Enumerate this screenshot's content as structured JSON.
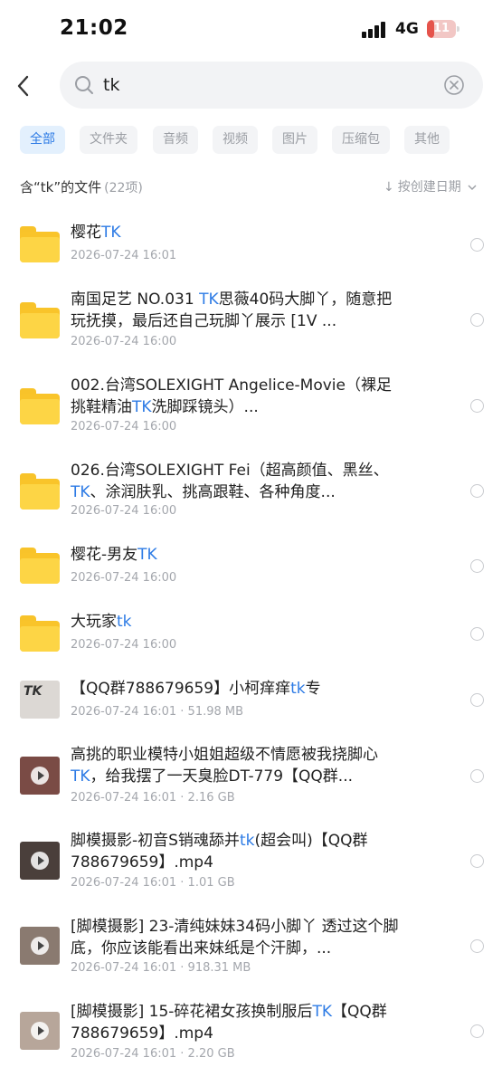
{
  "status": {
    "time": "21:02",
    "network": "4G",
    "battery": "11",
    "battery_level": 0.11
  },
  "search": {
    "query": "tk"
  },
  "filters": [
    {
      "label": "全部",
      "active": true
    },
    {
      "label": "文件夹",
      "active": false
    },
    {
      "label": "音频",
      "active": false
    },
    {
      "label": "视频",
      "active": false
    },
    {
      "label": "图片",
      "active": false
    },
    {
      "label": "压缩包",
      "active": false
    },
    {
      "label": "其他",
      "active": false
    }
  ],
  "results_header": {
    "label": "含“tk”的文件",
    "count": "(22项)",
    "sort_label": "按创建日期"
  },
  "items": [
    {
      "kind": "folder",
      "title_parts": [
        {
          "t": "樱花"
        },
        {
          "t": "TK",
          "hl": true
        }
      ],
      "meta": "2026-07-24 16:01"
    },
    {
      "kind": "folder",
      "title_parts": [
        {
          "t": "南国足艺 NO.031 "
        },
        {
          "t": "TK",
          "hl": true
        },
        {
          "t": "思薇40码大脚丫，随意把玩抚摸，最后还自己玩脚丫展示 [1V ..."
        }
      ],
      "meta": "2026-07-24 16:00"
    },
    {
      "kind": "folder",
      "title_parts": [
        {
          "t": "002.台湾SOLEXIGHT Angelice-Movie（裸足挑鞋精油"
        },
        {
          "t": "TK",
          "hl": true
        },
        {
          "t": "洗脚踩镜头）..."
        }
      ],
      "meta": "2026-07-24 16:00"
    },
    {
      "kind": "folder",
      "title_parts": [
        {
          "t": "026.台湾SOLEXIGHT Fei（超高颜值、黑丝、"
        },
        {
          "t": "TK",
          "hl": true
        },
        {
          "t": "、涂润肤乳、挑高跟鞋、各种角度..."
        }
      ],
      "meta": "2026-07-24 16:00"
    },
    {
      "kind": "folder",
      "title_parts": [
        {
          "t": "樱花-男友"
        },
        {
          "t": "TK",
          "hl": true
        }
      ],
      "meta": "2026-07-24 16:00"
    },
    {
      "kind": "folder",
      "title_parts": [
        {
          "t": "大玩家"
        },
        {
          "t": "tk",
          "hl": true
        }
      ],
      "meta": "2026-07-24 16:00"
    },
    {
      "kind": "video",
      "thumb_text": "TK",
      "thumb_color": "#dcd8d4",
      "title_parts": [
        {
          "t": "【QQ群788679659】小柯痒痒"
        },
        {
          "t": "tk",
          "hl": true
        },
        {
          "t": "专"
        }
      ],
      "meta": "2026-07-24 16:01 · 51.98 MB"
    },
    {
      "kind": "video",
      "thumb_color": "#7a4b45",
      "title_parts": [
        {
          "t": "高挑的职业模特小姐姐超级不情愿被我挠脚心"
        },
        {
          "t": "TK",
          "hl": true
        },
        {
          "t": "，给我摆了一天臭脸DT-779【QQ群..."
        }
      ],
      "meta": "2026-07-24 16:01 · 2.16 GB"
    },
    {
      "kind": "video",
      "thumb_color": "#4a3f3b",
      "title_parts": [
        {
          "t": "脚模摄影-初音S销魂舔并"
        },
        {
          "t": "tk",
          "hl": true
        },
        {
          "t": "(超会叫)【QQ群788679659】.mp4"
        }
      ],
      "meta": "2026-07-24 16:01 · 1.01 GB"
    },
    {
      "kind": "video",
      "thumb_color": "#8a7a70",
      "title_parts": [
        {
          "t": "[脚模摄影] 23-清纯妹妹34码小脚丫 透过这个脚底，你应该能看出来妹纸是个汗脚，..."
        }
      ],
      "meta": "2026-07-24 16:01 · 918.31 MB"
    },
    {
      "kind": "video",
      "thumb_color": "#b7a69a",
      "title_parts": [
        {
          "t": "[脚模摄影] 15-碎花裙女孩换制服后"
        },
        {
          "t": "TK",
          "hl": true
        },
        {
          "t": "【QQ群788679659】.mp4"
        }
      ],
      "meta": "2026-07-24 16:01 · 2.20 GB"
    }
  ]
}
